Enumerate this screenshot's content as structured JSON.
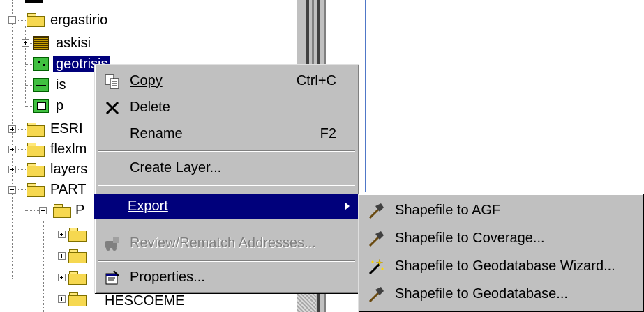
{
  "tree": {
    "items": [
      {
        "label": "ergastirio",
        "icon": "folder-icon"
      },
      {
        "label": "askisi",
        "icon": "raster-layer-icon"
      },
      {
        "label": "geotrisis",
        "icon": "point-layer-icon",
        "selected": true
      },
      {
        "label": "is",
        "icon": "line-layer-icon"
      },
      {
        "label": "p",
        "icon": "polygon-layer-icon"
      },
      {
        "label": "ESRI",
        "icon": "folder-icon"
      },
      {
        "label": "flexlm",
        "icon": "folder-icon"
      },
      {
        "label": "layers",
        "icon": "folder-icon"
      },
      {
        "label": "PART",
        "icon": "folder-icon"
      },
      {
        "label": "P",
        "icon": "folder-icon"
      },
      {
        "label": "HESCOEME",
        "icon": "folder-icon"
      }
    ]
  },
  "context_menu": {
    "items": [
      {
        "label": "Copy",
        "shortcut": "Ctrl+C",
        "icon": "copy-icon"
      },
      {
        "label": "Delete",
        "icon": "delete-x-icon"
      },
      {
        "label": "Rename",
        "shortcut": "F2"
      },
      {
        "label": "Create Layer..."
      },
      {
        "label": "Export",
        "icon": "submenu-arrow-icon",
        "highlighted": true
      },
      {
        "label": "Review/Rematch Addresses...",
        "icon": "geocode-icon",
        "disabled": true
      },
      {
        "label": "Properties...",
        "icon": "properties-icon"
      }
    ]
  },
  "export_submenu": {
    "items": [
      {
        "label": "Shapefile to AGF",
        "icon": "hammer-icon"
      },
      {
        "label": "Shapefile to Coverage...",
        "icon": "hammer-icon"
      },
      {
        "label": "Shapefile to Geodatabase Wizard...",
        "icon": "wizard-wand-icon"
      },
      {
        "label": "Shapefile to Geodatabase...",
        "icon": "hammer-icon"
      }
    ]
  },
  "colors": {
    "highlight": "#00007b",
    "menu_bg": "#c0c0c0",
    "folder": "#f6d850"
  }
}
